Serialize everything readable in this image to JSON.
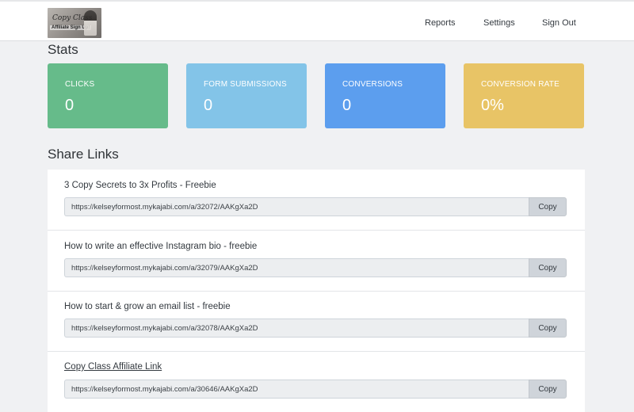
{
  "navbar": {
    "logo": {
      "script_text": "Copy Class",
      "sub_text": "Affiliate Sign Up!"
    },
    "links": [
      "Reports",
      "Settings",
      "Sign Out"
    ]
  },
  "stats": {
    "title": "Stats",
    "cards": [
      {
        "label": "CLICKS",
        "value": "0",
        "color": "#66bb8a"
      },
      {
        "label": "FORM SUBMISSIONS",
        "value": "0",
        "color": "#83c4e8"
      },
      {
        "label": "CONVERSIONS",
        "value": "0",
        "color": "#5c9eee"
      },
      {
        "label": "CONVERSION RATE",
        "value": "0%",
        "color": "#e8c466"
      }
    ]
  },
  "share_links": {
    "title": "Share Links",
    "copy_label": "Copy",
    "items": [
      {
        "title": "3 Copy Secrets to 3x Profits - Freebie",
        "url": "https://kelseyformost.mykajabi.com/a/32072/AAKgXa2D"
      },
      {
        "title": "How to write an effective Instagram bio - freebie",
        "url": "https://kelseyformost.mykajabi.com/a/32079/AAKgXa2D"
      },
      {
        "title": "How to start & grow an email list - freebie",
        "url": "https://kelseyformost.mykajabi.com/a/32078/AAKgXa2D"
      },
      {
        "title": "Copy Class Affiliate Link",
        "url": "https://kelseyformost.mykajabi.com/a/30646/AAKgXa2D",
        "is_link": true
      }
    ]
  }
}
